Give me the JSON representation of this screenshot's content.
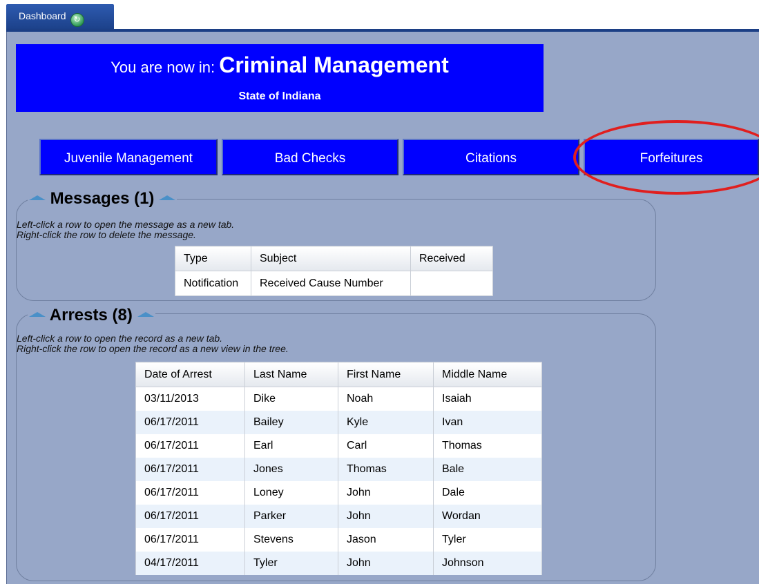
{
  "tab": {
    "label": "Dashboard"
  },
  "banner": {
    "prefix": "You are now in:",
    "module": "Criminal Management",
    "state": "State of Indiana"
  },
  "nav": [
    {
      "label": "Juvenile Management"
    },
    {
      "label": "Bad Checks"
    },
    {
      "label": "Citations"
    },
    {
      "label": "Forfeitures"
    }
  ],
  "messages": {
    "title": "Messages (1)",
    "hint1": "Left-click a row to open the message as a new tab.",
    "hint2": "Right-click the row to delete the message.",
    "columns": [
      "Type",
      "Subject",
      "Received"
    ],
    "rows": [
      [
        "Notification",
        "Received Cause Number",
        ""
      ]
    ]
  },
  "arrests": {
    "title": "Arrests (8)",
    "hint1": "Left-click a row to open the record as a new tab.",
    "hint2": "Right-click the row to open the record as a new view in the tree.",
    "columns": [
      "Date of Arrest",
      "Last Name",
      "First Name",
      "Middle Name"
    ],
    "rows": [
      [
        "03/11/2013",
        "Dike",
        "Noah",
        "Isaiah"
      ],
      [
        "06/17/2011",
        "Bailey",
        "Kyle",
        "Ivan"
      ],
      [
        "06/17/2011",
        "Earl",
        "Carl",
        "Thomas"
      ],
      [
        "06/17/2011",
        "Jones",
        "Thomas",
        "Bale"
      ],
      [
        "06/17/2011",
        "Loney",
        "John",
        "Dale"
      ],
      [
        "06/17/2011",
        "Parker",
        "John",
        "Wordan"
      ],
      [
        "06/17/2011",
        "Stevens",
        "Jason",
        "Tyler"
      ],
      [
        "04/17/2011",
        "Tyler",
        "John",
        "Johnson"
      ]
    ]
  },
  "colors": {
    "banner": "#0000ff",
    "background": "#97a7c8",
    "highlight": "#e01f1f"
  }
}
